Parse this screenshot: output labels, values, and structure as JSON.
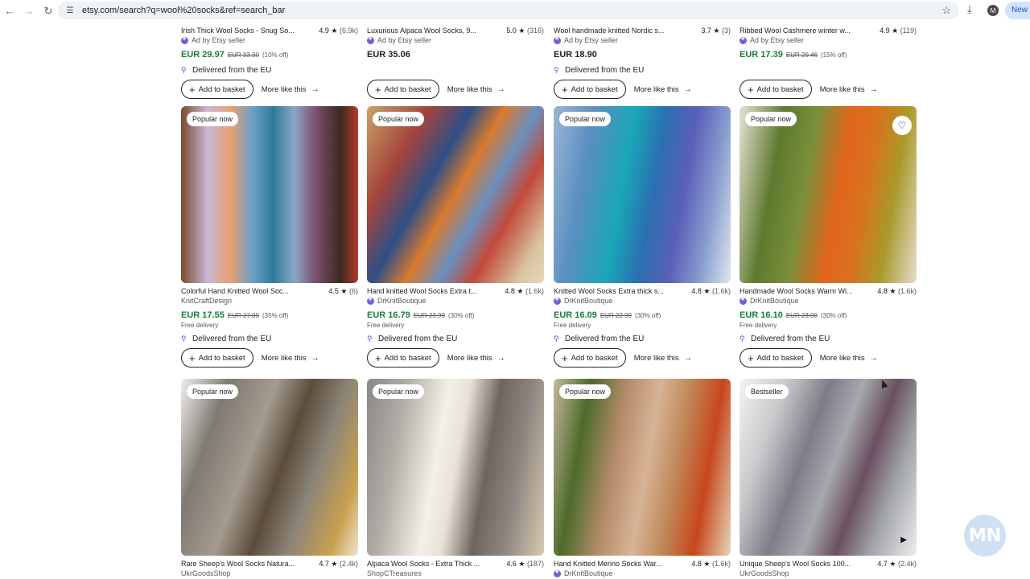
{
  "browser": {
    "url": "etsy.com/search?q=wool%20socks&ref=search_bar",
    "profile_initial": "M",
    "new_chip": "New C"
  },
  "common": {
    "add_to_basket": "Add to basket",
    "more_like_this": "More like this",
    "delivered": "Delivered from the EU",
    "free_delivery": "Free delivery",
    "ad_label": "Ad by Etsy seller"
  },
  "products": [
    {
      "title": "Irish Thick Wool Socks - Snug So...",
      "rating": "4.9",
      "count": "(6.9k)",
      "shop": "Ad by Etsy seller",
      "price": "EUR 29.97",
      "old": "EUR 33.30",
      "off": "(10% off)"
    },
    {
      "title": "Luxurious Alpaca Wool Socks, 9...",
      "rating": "5.0",
      "count": "(316)",
      "shop": "Ad by Etsy seller",
      "price": "EUR 35.06"
    },
    {
      "title": "Wool handmade knitted Nordic s...",
      "rating": "3.7",
      "count": "(3)",
      "shop": "Ad by Etsy seller",
      "price": "EUR 18.90"
    },
    {
      "title": "Ribbed Wool Cashmere winter w...",
      "rating": "4.9",
      "count": "(119)",
      "shop": "Ad by Etsy seller",
      "price": "EUR 17.39",
      "old": "EUR 20.46",
      "off": "(15% off)"
    },
    {
      "title": "Colorful Hand Knitted Wool Soc...",
      "rating": "4.5",
      "count": "(6)",
      "shop": "KnitCraftDesign",
      "price": "EUR 17.55",
      "old": "EUR 27.00",
      "off": "(35% off)",
      "badge": "Popular now"
    },
    {
      "title": "Hand knitted Wool Socks Extra t...",
      "rating": "4.8",
      "count": "(1.6k)",
      "shop": "DrKnitBoutique",
      "price": "EUR 16.79",
      "old": "EUR 23.99",
      "off": "(30% off)",
      "badge": "Popular now"
    },
    {
      "title": "Knitted Wool Socks Extra thick s...",
      "rating": "4.8",
      "count": "(1.6k)",
      "shop": "DrKnitBoutique",
      "price": "EUR 16.09",
      "old": "EUR 22.99",
      "off": "(30% off)",
      "badge": "Popular now"
    },
    {
      "title": "Handmade Wool Socks Warm Wi...",
      "rating": "4.8",
      "count": "(1.6k)",
      "shop": "DrKnitBoutique",
      "price": "EUR 16.10",
      "old": "EUR 23.00",
      "off": "(30% off)",
      "badge": "Popular now"
    },
    {
      "title": "Rare Sheep's Wool Socks Natura...",
      "rating": "4.7",
      "count": "(2.4k)",
      "shop": "UkrGoodsShop",
      "badge": "Popular now"
    },
    {
      "title": "Alpaca Wool Socks - Extra Thick ...",
      "rating": "4.6",
      "count": "(187)",
      "shop": "ShopCTreasures",
      "badge": "Popular now"
    },
    {
      "title": "Hand Knitted Merino Socks War...",
      "rating": "4.8",
      "count": "(1.6k)",
      "shop": "DrKnitBoutique",
      "badge": "Popular now"
    },
    {
      "title": "Unique Sheep's Wool Socks 100...",
      "rating": "4.7",
      "count": "(2.4k)",
      "shop": "UkrGoodsShop",
      "badge": "Bestseller"
    }
  ],
  "colors": {
    "sale_green": "#1a7f37",
    "star_seller_purple": "#7b5bd6",
    "accent_blue": "#3d5bd6"
  },
  "icons": [
    "back-icon",
    "forward-icon",
    "reload-icon",
    "site-settings-icon",
    "bookmark-star-icon",
    "download-icon",
    "pin-icon",
    "plus-icon",
    "arrow-right-icon",
    "heart-icon",
    "play-icon"
  ]
}
